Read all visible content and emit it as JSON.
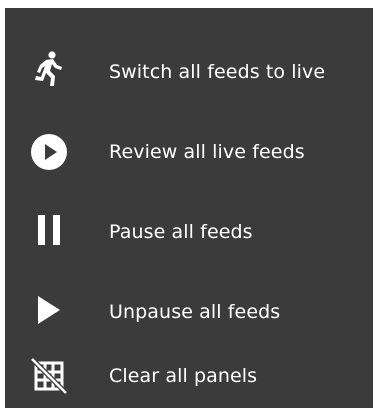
{
  "menu": {
    "background": "#3b3b3b",
    "text_color": "#ffffff",
    "items": [
      {
        "label": "Switch all feeds to live",
        "icon": "running-person-icon"
      },
      {
        "label": "Review all live feeds",
        "icon": "play-circle-icon"
      },
      {
        "label": "Pause all feeds",
        "icon": "pause-icon"
      },
      {
        "label": "Unpause all feeds",
        "icon": "play-icon"
      },
      {
        "label": "Clear all panels",
        "icon": "grid-off-icon"
      }
    ]
  }
}
